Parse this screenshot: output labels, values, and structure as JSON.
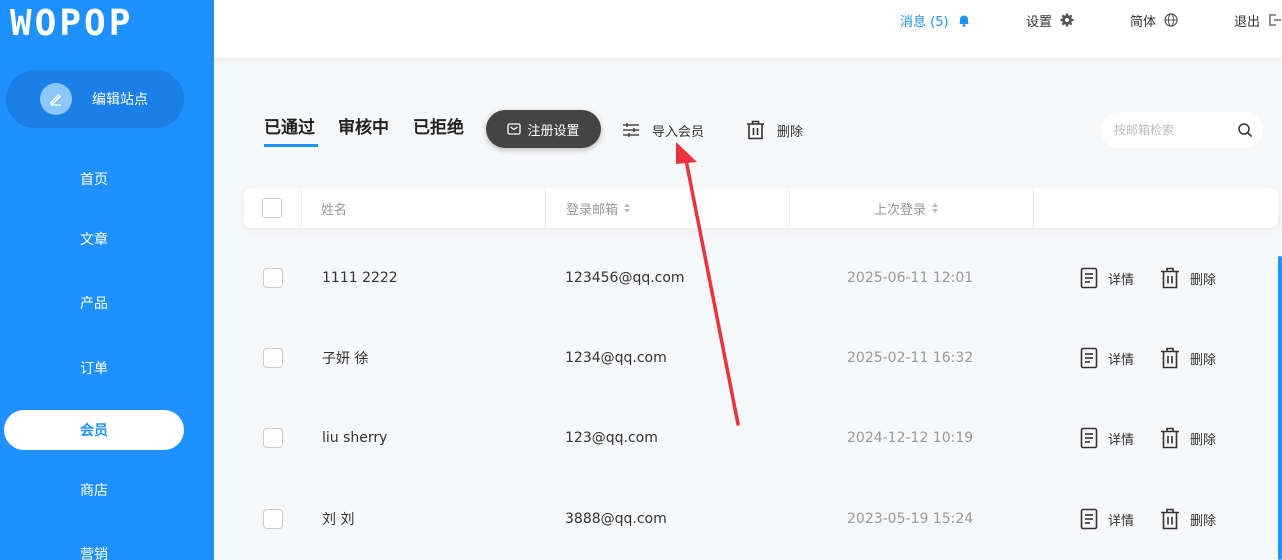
{
  "logo": "WOPOP",
  "sidebar": {
    "edit_site": "编辑站点",
    "items": [
      {
        "label": "首页"
      },
      {
        "label": "文章"
      },
      {
        "label": "产品"
      },
      {
        "label": "订单"
      },
      {
        "label": "会员",
        "active": true
      },
      {
        "label": "商店"
      },
      {
        "label": "营销"
      }
    ]
  },
  "header": {
    "messages": "消息 (5)",
    "settings": "设置",
    "language": "简体",
    "logout": "退出"
  },
  "tabs": [
    {
      "label": "已通过",
      "active": true
    },
    {
      "label": "审核中"
    },
    {
      "label": "已拒绝"
    }
  ],
  "toolbar": {
    "register_settings": "注册设置",
    "import_members": "导入会员",
    "delete": "删除",
    "search_placeholder": "按邮箱检索"
  },
  "table": {
    "columns": [
      "姓名",
      "登录邮箱",
      "上次登录"
    ],
    "rows": [
      {
        "name": "1111 2222",
        "email": "123456@qq.com",
        "last_login": "2025-06-11 12:01"
      },
      {
        "name": "子妍 徐",
        "email": "1234@qq.com",
        "last_login": "2025-02-11 16:32"
      },
      {
        "name": "liu sherry",
        "email": "123@qq.com",
        "last_login": "2024-12-12 10:19"
      },
      {
        "name": "刘 刘",
        "email": "3888@qq.com",
        "last_login": "2023-05-19 15:24"
      }
    ],
    "actions": {
      "detail": "详情",
      "delete": "删除"
    }
  },
  "colors": {
    "primary": "#1e90ff",
    "annotation_arrow": "#e8343a"
  }
}
